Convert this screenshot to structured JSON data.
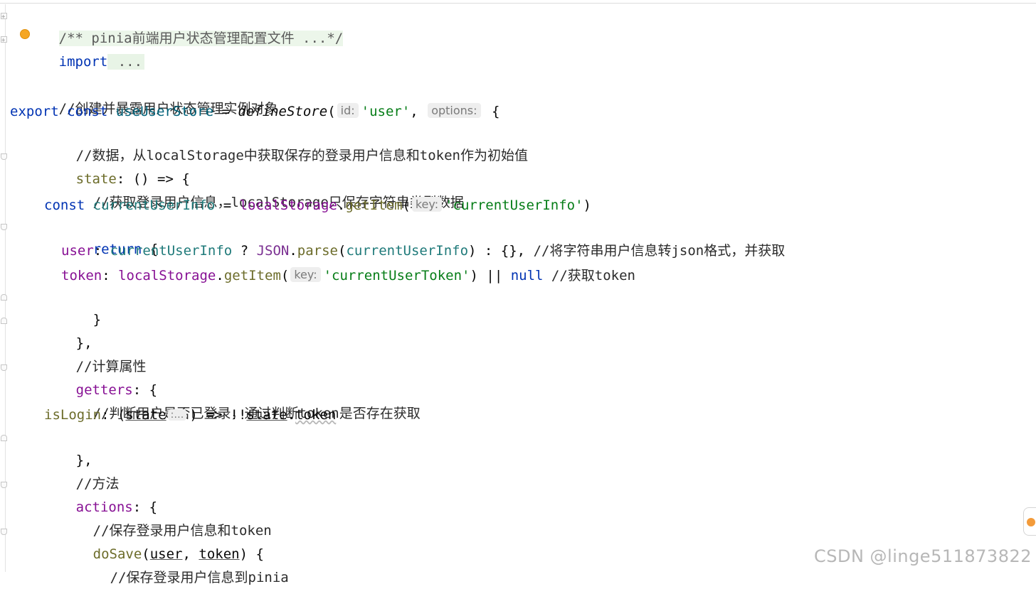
{
  "lines": [
    {
      "text": "/** pinia前端用户状态管理配置文件 ...*/"
    },
    {
      "import_kw": "import",
      "import_rest": " ..."
    },
    {
      "text": ""
    },
    {
      "text": "//创建并暴露用户状态管理实例对象"
    },
    {
      "export": "export",
      "const": "const",
      "name": "useUserStore",
      "eq": " = ",
      "fn": "defineStore",
      "hint_id": "id:",
      "user_str": "'user'",
      "hint_options": "options:",
      "brace": " {"
    },
    {
      "text": "//数据，从localStorage中获取保存的登录用户信息和token作为初始值"
    },
    {
      "prop": "state",
      "rest": ": () => {"
    },
    {
      "text": "//获取登录用户信息，localStorage只保存字符串类型数据"
    },
    {
      "const": "const",
      "var": "currentUserInfo",
      "eq": " = ",
      "obj": "localStorage",
      "dot": ".",
      "method": "getItem",
      "hint": "key:",
      "str": "'currentUserInfo'",
      "close": ")"
    },
    {
      "kw": "return",
      "rest": " {"
    },
    {
      "prop": "user",
      "colon": ": ",
      "var": "currentUserInfo",
      "q": " ? ",
      "json": "JSON",
      "dot": ".",
      "method": "parse",
      "open": "(",
      "var2": "currentUserInfo",
      "rest": ") : {}, ",
      "comment": "//将字符串用户信息转json格式，并获取"
    },
    {
      "prop": "token",
      "colon": ": ",
      "obj": "localStorage",
      "dot": ".",
      "method": "getItem",
      "hint": "key:",
      "str": "'currentUserToken'",
      "or": ") || ",
      "null": "null",
      "comment": " //获取token"
    },
    {
      "text": "}"
    },
    {
      "text": "},"
    },
    {
      "text": "//计算属性"
    },
    {
      "prop": "getters",
      "rest": ": {"
    },
    {
      "text": "//判断用户是否已登录，通过判断token是否存在获取"
    },
    {
      "fn": "isLogin",
      "colon": ": (",
      "param": "state",
      "hint": ":…",
      "arrow": ") => !!",
      "state": "state",
      "dot": ".",
      "token": "token"
    },
    {
      "text": "},"
    },
    {
      "text": "//方法"
    },
    {
      "prop": "actions",
      "rest": ": {"
    },
    {
      "text": "//保存登录用户信息和token"
    },
    {
      "fn": "doSave",
      "open": "(",
      "p1": "user",
      "sep": ", ",
      "p2": "token",
      "close": ") {"
    },
    {
      "text": "//保存登录用户信息到pinia"
    }
  ],
  "watermark": "CSDN @linge511873822",
  "colors": {
    "keyword": "#0033b3",
    "string": "#067d17",
    "property": "#871094",
    "comment": "#8c8c8c",
    "accent": "#f5a623"
  }
}
